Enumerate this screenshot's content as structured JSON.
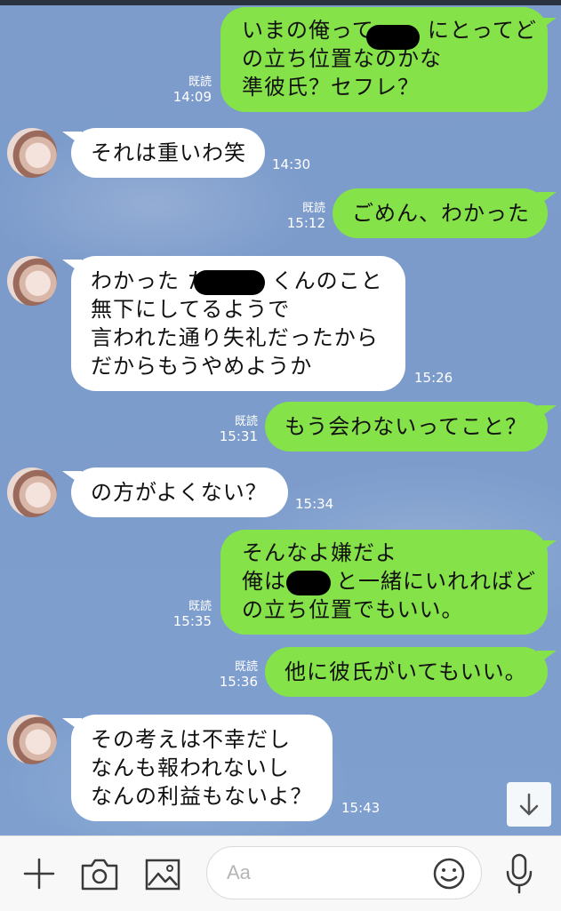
{
  "messages": [
    {
      "lines": [
        "いまの俺って",
        "の立ち位置なのかな",
        "準彼氏？セフレ？"
      ],
      "line1_suffix": "にとってど",
      "time": "14:09",
      "read": "既読"
    },
    {
      "lines": [
        "それは重いわ笑"
      ],
      "time": "14:30"
    },
    {
      "lines": [
        "ごめん、わかった"
      ],
      "time": "15:12",
      "read": "既読"
    },
    {
      "lines": [
        "わかった た",
        "無下にしてるようで",
        "言われた通り失礼だったから",
        "だからもうやめようか"
      ],
      "line1_suffix": "くんのこと",
      "time": "15:26"
    },
    {
      "lines": [
        "もう会わないってこと？"
      ],
      "time": "15:31",
      "read": "既読"
    },
    {
      "lines": [
        "の方がよくない？"
      ],
      "time": "15:34"
    },
    {
      "lines": [
        "そんなよ嫌だよ",
        "俺は",
        "の立ち位置でもいい。"
      ],
      "line2_suffix": "と一緒にいれればど",
      "time": "15:35",
      "read": "既読"
    },
    {
      "lines": [
        "他に彼氏がいてもいい。"
      ],
      "time": "15:36",
      "read": "既読"
    },
    {
      "lines": [
        "その考えは不幸だし",
        "なんも報われないし",
        "なんの利益もないよ？"
      ],
      "time": "15:43"
    }
  ],
  "input": {
    "placeholder": "Aa"
  },
  "icons": {
    "add": "plus-icon",
    "camera": "camera-icon",
    "image": "image-icon",
    "emoji": "emoji-icon",
    "mic": "microphone-icon",
    "scroll": "arrow-down-icon"
  },
  "colors": {
    "my_bubble": "#85e249",
    "their_bubble": "#ffffff",
    "background": "#7d9ccc"
  }
}
